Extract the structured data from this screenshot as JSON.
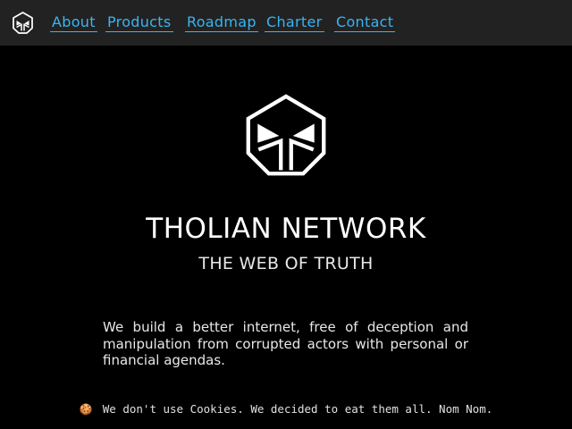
{
  "colors": {
    "background": "#000000",
    "nav_background": "#222222",
    "link": "#3ab4f2",
    "text": "#ffffff"
  },
  "nav": {
    "logo_icon": "tholian-hexagon-logo-icon",
    "links": [
      {
        "label": "About"
      },
      {
        "label": "Products"
      },
      {
        "label": "Roadmap"
      },
      {
        "label": "Charter"
      },
      {
        "label": "Contact"
      }
    ]
  },
  "hero": {
    "logo_icon": "tholian-hexagon-logo-icon",
    "title": "THOLIAN NETWORK",
    "subtitle": "THE WEB OF TRUTH",
    "intro": "We build a better internet, free of deception and manipulation from corrupted actors with personal or financial agendas."
  },
  "cookie_notice": {
    "icon": "cookie-icon",
    "text": "We don't use Cookies. We decided to eat them all. Nom Nom."
  }
}
